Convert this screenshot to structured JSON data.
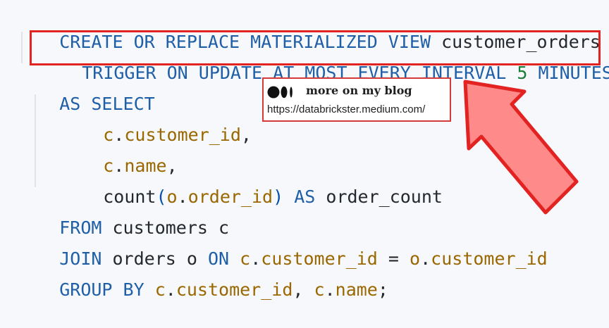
{
  "code": {
    "line1": {
      "kw": "CREATE OR REPLACE MATERIALIZED VIEW",
      "name": "customer_orders"
    },
    "line2": {
      "kw": "TRIGGER ON UPDATE AT MOST EVERY INTERVAL",
      "number": "5",
      "unit": "MINUTES"
    },
    "line3": {
      "kw": "AS SELECT"
    },
    "line4": {
      "alias": "c",
      "column": "customer_id",
      "comma": ","
    },
    "line5": {
      "alias": "c",
      "column": "name",
      "comma": ","
    },
    "line6": {
      "func": "count",
      "open": "(",
      "alias": "o",
      "column": "order_id",
      "close": ")",
      "as_kw": "AS",
      "result": "order_count"
    },
    "line7": {
      "kw": "FROM",
      "table": "customers c"
    },
    "line8": {
      "kw": "JOIN",
      "table": "orders o",
      "on_kw": "ON",
      "left_alias": "c",
      "left_column": "customer_id",
      "equals": "=",
      "right_alias": "o",
      "right_column": "customer_id"
    },
    "line9": {
      "kw": "GROUP BY",
      "alias1": "c",
      "column1": "customer_id",
      "comma": ",",
      "alias2": "c",
      "column2": "name",
      "semicolon": ";"
    }
  },
  "blog": {
    "title": "more on my blog",
    "url": "https://databrickster.medium.com/"
  },
  "colors": {
    "keyword": "#1f5fa8",
    "identifier": "#9a6700",
    "number": "#1a7f37",
    "highlight_border": "#e32222",
    "arrow_fill": "#ff8a8a",
    "arrow_stroke": "#e32222"
  },
  "icons": {
    "blog_logo": "medium-logo-icon",
    "arrow": "pointer-arrow-icon"
  }
}
